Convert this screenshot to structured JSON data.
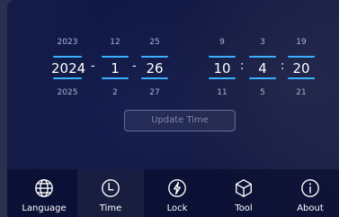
{
  "date": {
    "year": {
      "prev": "2023",
      "value": "2024",
      "next": "2025"
    },
    "month": {
      "prev": "12",
      "value": "1",
      "next": "2"
    },
    "day": {
      "prev": "25",
      "value": "26",
      "next": "27"
    },
    "separator_date": "-"
  },
  "time": {
    "hour": {
      "prev": "9",
      "value": "10",
      "next": "11"
    },
    "minute": {
      "prev": "3",
      "value": "4",
      "next": "5"
    },
    "second": {
      "prev": "19",
      "value": "20",
      "next": "21"
    },
    "separator_time": ":"
  },
  "update_button": "Update Time",
  "nav": {
    "items": [
      {
        "label": "Language",
        "icon": "globe-icon"
      },
      {
        "label": "Time",
        "icon": "clock-icon"
      },
      {
        "label": "Lock",
        "icon": "lock-bolt-icon"
      },
      {
        "label": "Tool",
        "icon": "cube-icon"
      },
      {
        "label": "About",
        "icon": "info-icon"
      }
    ],
    "active": "Time"
  },
  "colors": {
    "accent": "#3ab0ff",
    "overlay": "#0a1246"
  }
}
